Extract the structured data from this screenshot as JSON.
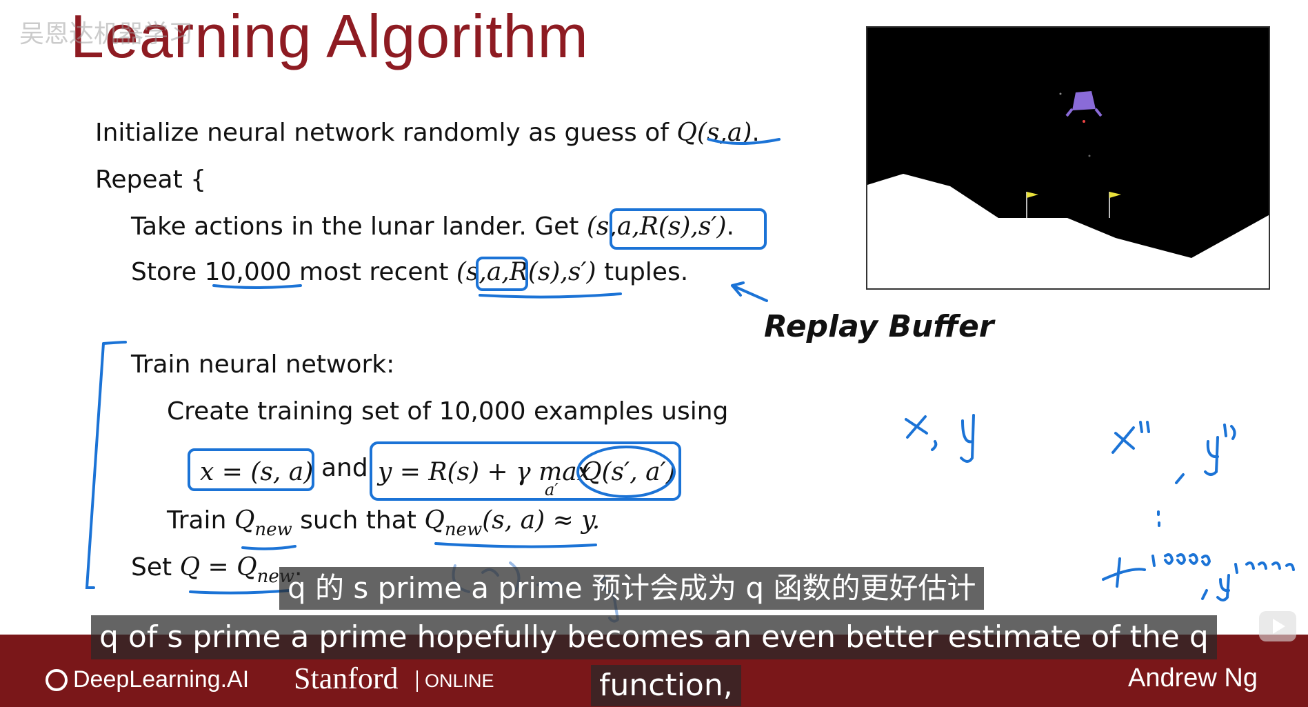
{
  "slide": {
    "title": "Learning Algorithm",
    "watermark": "吴恩达机器学习",
    "line1_text": "Initialize neural network randomly as guess of ",
    "line1_math": "Q(s,a)",
    "line1_end": ".",
    "line2": "Repeat {",
    "line3_text": "Take actions in the lunar lander. Get ",
    "line3_math": "(s,a,R(s),s′)",
    "line3_end": ".",
    "line4_a": "Store ",
    "line4_num": "10,000",
    "line4_b": " most recent ",
    "line4_math": "(s,a,R(s),s′)",
    "line4_c": " tuples.",
    "line5": "Train neural network:",
    "line6": "Create training set of 10,000 examples using",
    "line7_x": "x =  (s, a)",
    "line7_and": "and",
    "line7_y": "y = R(s) + γ max",
    "line7_sub": "a′",
    "line7_q": "Q(s′, a′)",
    "line8_a": "Train ",
    "line8_q": "Q",
    "line8_sub": "new",
    "line8_b": " such that ",
    "line8_q2": "Q",
    "line8_sub2": "new",
    "line8_c": "(s, a) ≈ y.",
    "line9_a": "Set ",
    "line9_q": "Q = Q",
    "line9_sub": "new",
    "line9_end": "."
  },
  "annotations": {
    "replay_buffer": "Replay Buffer",
    "xy": "x, y",
    "x1y1": "x⁽¹⁾ , y⁽¹⁾",
    "dots": ":",
    "x10000": "x¹⁰⁰⁰⁰, y¹⁰⁰⁰⁰"
  },
  "footer": {
    "brand1": "DeepLearning.AI",
    "brand2": "Stanford",
    "brand2_sub": "ONLINE",
    "author": "Andrew Ng"
  },
  "captions": {
    "zh": "q 的 s prime a prime 预计会成为 q 函数的更好估计",
    "en_line1": "q of s prime a prime hopefully becomes an even better estimate of the q",
    "en_line2": "function,"
  },
  "colors": {
    "title": "#8e1b22",
    "ink": "#1b73d6",
    "footer": "#7a1719",
    "flag": "#e8e03a",
    "lander": "#8a6bd8"
  }
}
